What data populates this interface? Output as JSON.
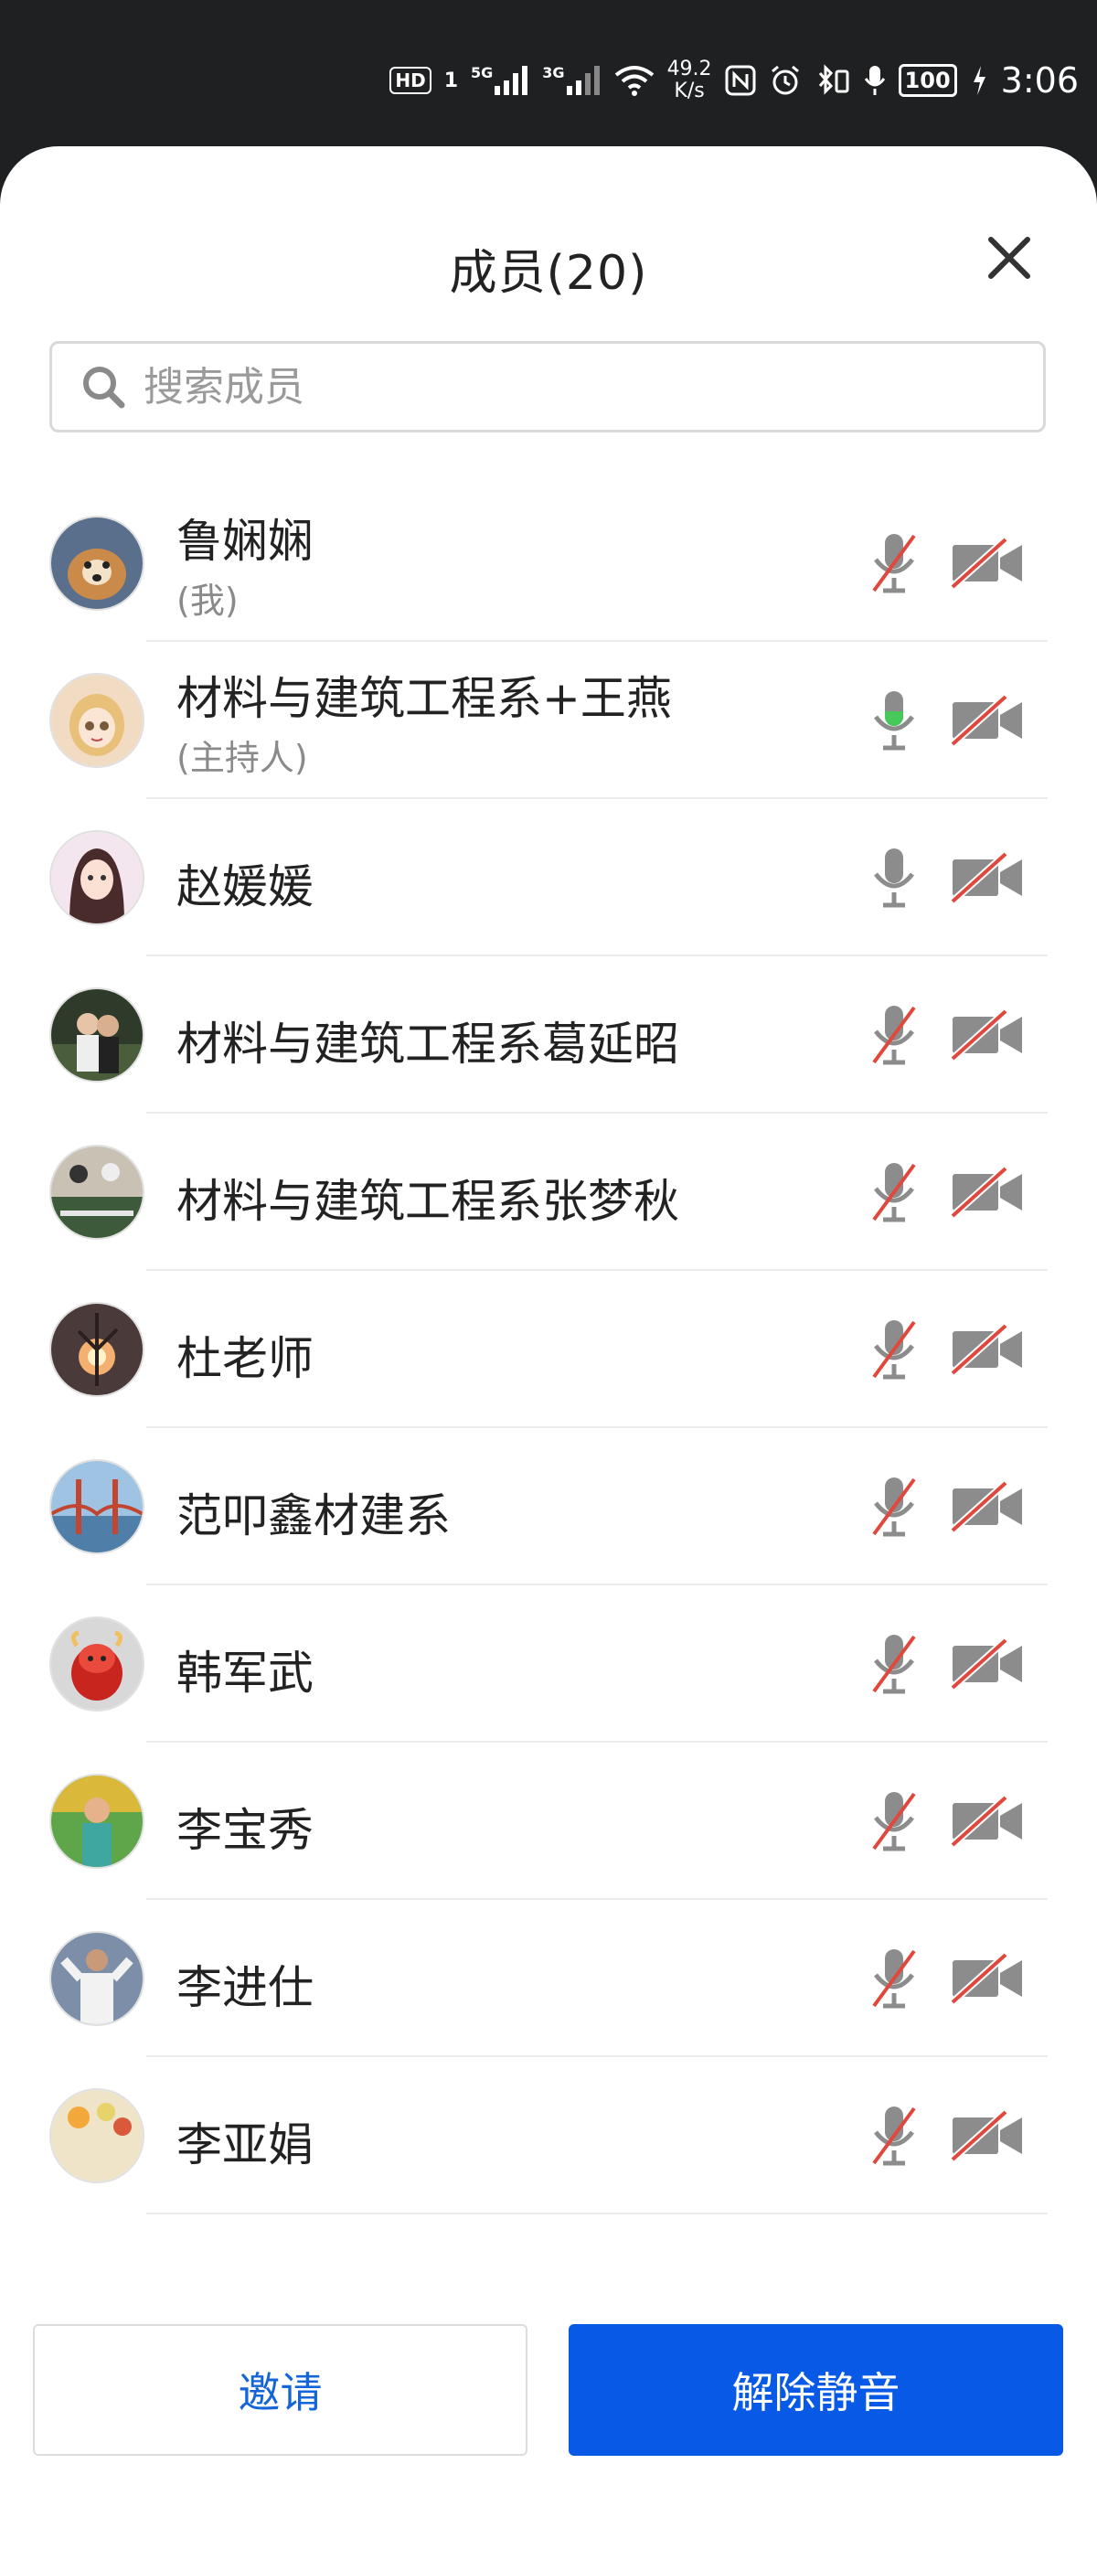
{
  "status_bar": {
    "hd": "HD",
    "sim1": "1",
    "net1": "5G",
    "net2": "3G",
    "speed_value": "49.2",
    "speed_unit": "K/s",
    "nfc": "N",
    "battery": "100",
    "time": "3:06"
  },
  "header": {
    "title": "成员(20)"
  },
  "search": {
    "placeholder": "搜索成员"
  },
  "members": [
    {
      "name": "鲁娴娴",
      "role": "(我)",
      "mic": "muted",
      "cam": "off"
    },
    {
      "name": "材料与建筑工程系+王燕",
      "role": "(主持人)",
      "mic": "active",
      "cam": "off"
    },
    {
      "name": "赵媛媛",
      "role": "",
      "mic": "on",
      "cam": "off"
    },
    {
      "name": "材料与建筑工程系葛延昭",
      "role": "",
      "mic": "muted",
      "cam": "off"
    },
    {
      "name": "材料与建筑工程系张梦秋",
      "role": "",
      "mic": "muted",
      "cam": "off"
    },
    {
      "name": "杜老师",
      "role": "",
      "mic": "muted",
      "cam": "off"
    },
    {
      "name": "范叩鑫材建系",
      "role": "",
      "mic": "muted",
      "cam": "off"
    },
    {
      "name": "韩军武",
      "role": "",
      "mic": "muted",
      "cam": "off"
    },
    {
      "name": "李宝秀",
      "role": "",
      "mic": "muted",
      "cam": "off"
    },
    {
      "name": "李进仕",
      "role": "",
      "mic": "muted",
      "cam": "off"
    },
    {
      "name": "李亚娟",
      "role": "",
      "mic": "muted",
      "cam": "off"
    }
  ],
  "footer": {
    "invite_label": "邀请",
    "unmute_label": "解除静音"
  },
  "colors": {
    "accent": "#0759e6",
    "invite_text": "#1565d8",
    "muted_slash": "#e0483e",
    "mic_active": "#46c95a",
    "icon_gray": "#8c8c8c"
  }
}
